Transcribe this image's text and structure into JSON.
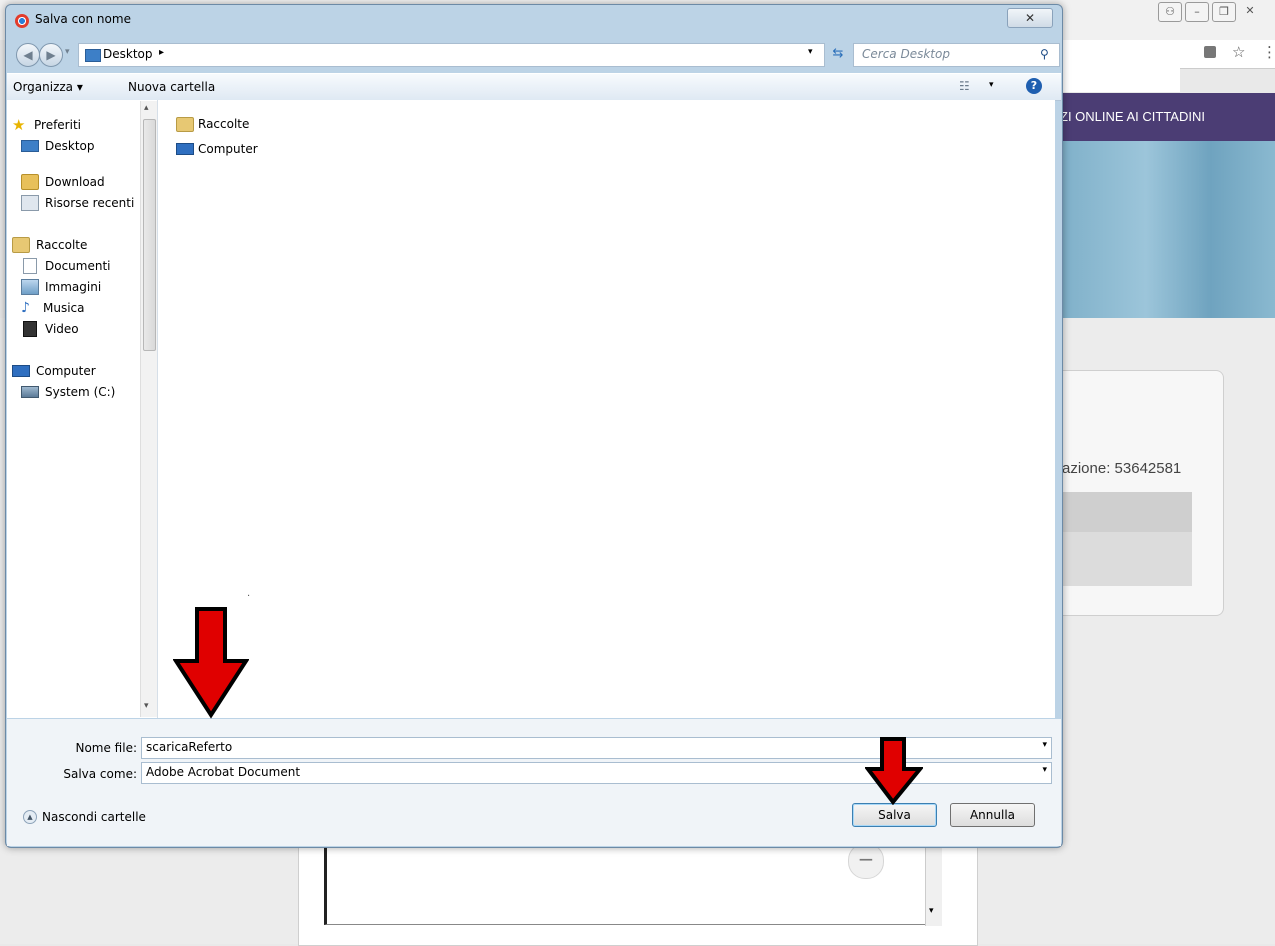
{
  "background_page": {
    "banner_text": "ZI ONLINE AI CITTADINI",
    "card_text": "azione: 53642581",
    "window_controls": [
      "person-icon",
      "minimize-icon",
      "restore-icon",
      "close-icon"
    ]
  },
  "dialog": {
    "title": "Salva con nome",
    "close_symbol": "✕",
    "breadcrumb": {
      "location": "Desktop",
      "separator": "▸"
    },
    "search": {
      "placeholder": "Cerca Desktop"
    },
    "toolbar": {
      "organize_label": "Organizza ▾",
      "new_folder_label": "Nuova cartella",
      "help_symbol": "?"
    },
    "nav_pane": {
      "items": [
        {
          "label": "Preferiti",
          "icon": "star-icon"
        },
        {
          "label": "Desktop",
          "icon": "desktop-icon"
        },
        {
          "label": "Download",
          "icon": "download-folder-icon"
        },
        {
          "label": "Risorse recenti",
          "icon": "recent-places-icon"
        },
        {
          "label": "Raccolte",
          "icon": "libraries-icon"
        },
        {
          "label": "Documenti",
          "icon": "documents-icon"
        },
        {
          "label": "Immagini",
          "icon": "pictures-icon"
        },
        {
          "label": "Musica",
          "icon": "music-icon"
        },
        {
          "label": "Video",
          "icon": "video-icon"
        },
        {
          "label": "Computer",
          "icon": "computer-icon"
        },
        {
          "label": "System (C:)",
          "icon": "drive-icon"
        }
      ]
    },
    "files": [
      {
        "label": "Raccolte",
        "icon": "libraries-icon"
      },
      {
        "label": "Computer",
        "icon": "computer-icon"
      }
    ],
    "form": {
      "filename_label": "Nome file:",
      "filename_value": "scaricaReferto",
      "savetype_label": "Salva come:",
      "savetype_value": "Adobe Acrobat Document"
    },
    "footer": {
      "hide_folders_label": "Nascondi cartelle",
      "save_label": "Salva",
      "cancel_label": "Annulla"
    }
  },
  "colors": {
    "annotation_arrow": "#e00000",
    "banner": "#4b3d74",
    "dialog_frame": "#bcd3e6"
  }
}
